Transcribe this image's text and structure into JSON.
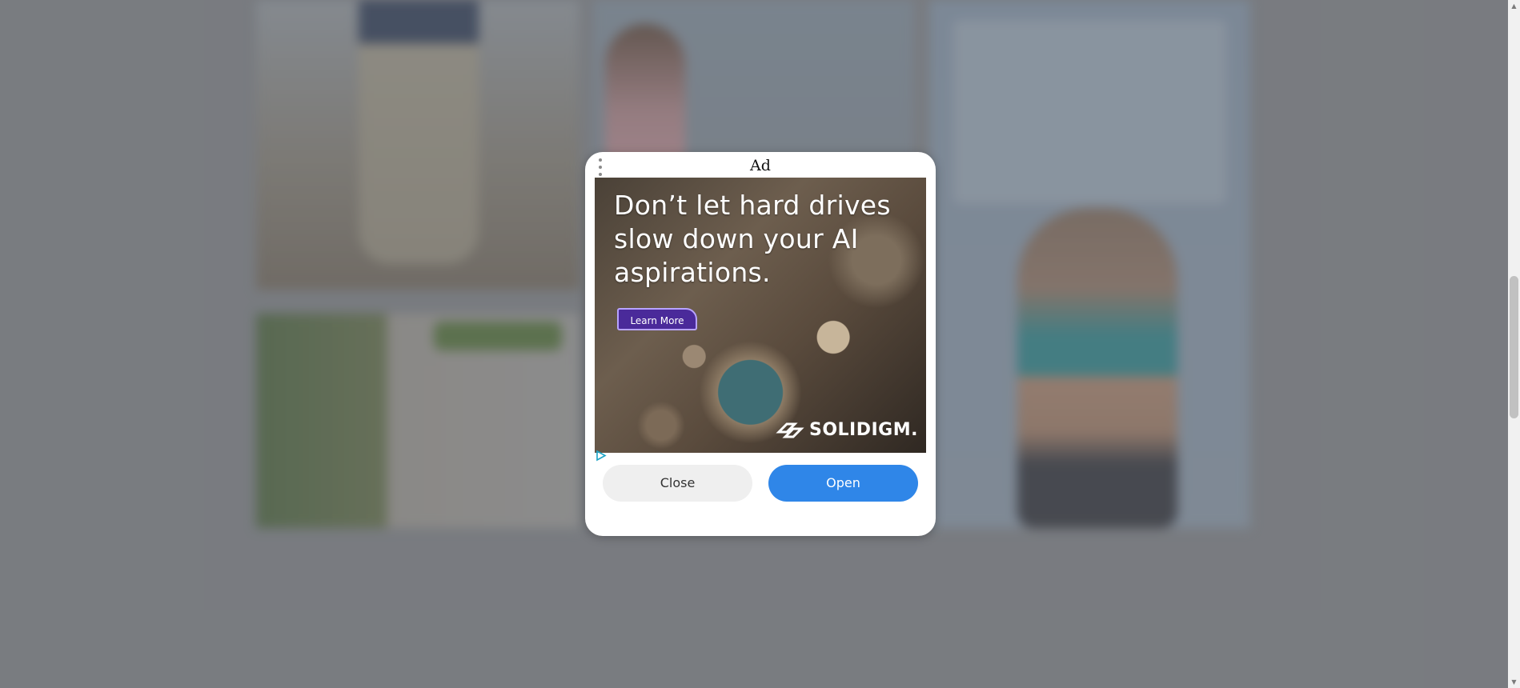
{
  "modal": {
    "ad_label": "Ad",
    "menu_icon": "more-vertical-icon",
    "creative": {
      "headline": "Don’t let hard drives slow down your AI aspirations.",
      "cta_label": "Learn More",
      "brand_name": "SOLIDIGM."
    },
    "adchoices_icon": "adchoices-icon",
    "close_label": "Close",
    "open_label": "Open"
  },
  "colors": {
    "open_button": "#2f86e8",
    "close_button": "#efefef",
    "cta_button": "#4a2a9a"
  },
  "scrollbar": {
    "up_icon": "▲",
    "down_icon": "▼"
  }
}
